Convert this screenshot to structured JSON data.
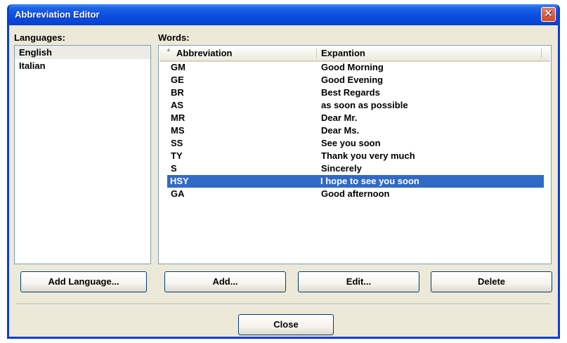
{
  "window": {
    "title": "Abbreviation Editor",
    "close_glyph": "✕"
  },
  "languages": {
    "label": "Languages:",
    "items": [
      "English",
      "Italian"
    ],
    "selected": "English"
  },
  "words": {
    "label": "Words:",
    "columns": [
      "Abbreviation",
      "Expantion"
    ],
    "sort_glyph": "▲",
    "rows": [
      [
        "GM",
        "Good Morning"
      ],
      [
        "GE",
        "Good Evening"
      ],
      [
        "BR",
        "Best Regards"
      ],
      [
        "AS",
        "as soon as possible"
      ],
      [
        "MR",
        "Dear Mr."
      ],
      [
        "MS",
        "Dear Ms."
      ],
      [
        "SS",
        "See you soon"
      ],
      [
        "TY",
        "Thank you very much"
      ],
      [
        "S",
        "Sincerely"
      ],
      [
        "HSY",
        "I hope to see you soon"
      ],
      [
        "GA",
        "Good afternoon"
      ]
    ],
    "selected_row": "HSY"
  },
  "buttons": {
    "add_language": "Add Language...",
    "add": "Add...",
    "edit": "Edit...",
    "delete": "Delete",
    "close": "Close"
  },
  "colors": {
    "title_bar": "#0a4ee0",
    "selection": "#316ac5",
    "dialog_bg": "#ece9d8"
  }
}
